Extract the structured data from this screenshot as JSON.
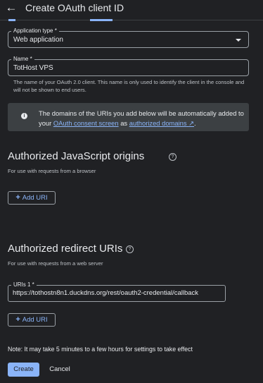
{
  "header": {
    "back_icon": "arrow-back-icon",
    "title": "Create OAuth client ID"
  },
  "application_type": {
    "label": "Application type *",
    "value": "Web application"
  },
  "name": {
    "label": "Name *",
    "value": "TotHost VPS",
    "hint": "The name of your OAuth 2.0 client. This name is only used to identify the client in the console and will not be shown to end users."
  },
  "banner": {
    "icon": "info-icon",
    "text_start": "The domains of the URIs you add below will be automatically added to your ",
    "link_consent": "OAuth consent screen",
    "text_middle": " as ",
    "link_domains": "authorized domains",
    "text_end": "."
  },
  "js_origins": {
    "heading": "Authorized JavaScript origins",
    "subtitle": "For use with requests from a browser",
    "add_button": "Add URI"
  },
  "redirect_uris": {
    "heading": "Authorized redirect URIs",
    "subtitle": "For use with requests from a web server",
    "uri_label": "URIs 1 *",
    "uri_value": "https://tothostn8n1.duckdns.org/rest/oauth2-credential/callback",
    "add_button": "Add URI"
  },
  "note": "Note: It may take 5 minutes to a few hours for settings to take effect",
  "actions": {
    "create": "Create",
    "cancel": "Cancel"
  },
  "colors": {
    "background": "#202124",
    "accent": "#8ab4f8",
    "banner": "#3c4043"
  }
}
